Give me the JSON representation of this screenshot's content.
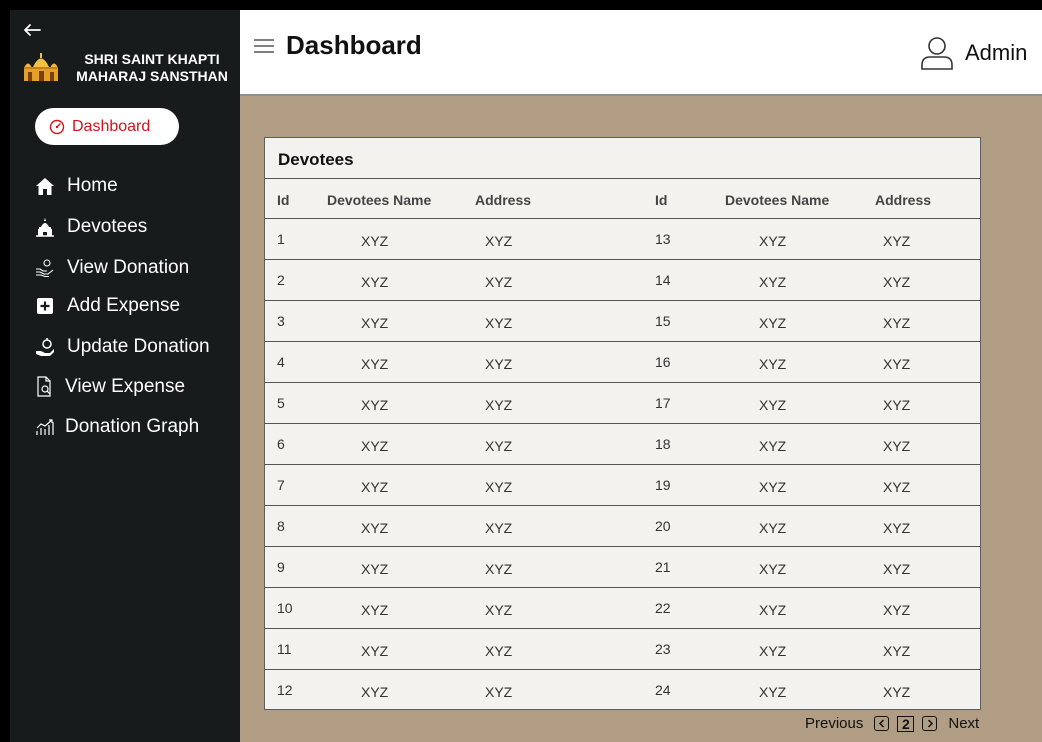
{
  "sidebar": {
    "brand_line1": "SHRI SAINT KHAPTI",
    "brand_line2": "MAHARAJ SANSTHAN",
    "active_label": "Dashboard",
    "items": [
      {
        "label": "Home",
        "icon": "home-icon"
      },
      {
        "label": "Devotees",
        "icon": "temple-icon"
      },
      {
        "label": "View Donation",
        "icon": "donation-hand-icon"
      },
      {
        "label": "Add Expense",
        "icon": "plus-square-icon"
      },
      {
        "label": "Update Donation",
        "icon": "money-hand-icon"
      },
      {
        "label": "View Expense",
        "icon": "document-search-icon"
      },
      {
        "label": "Donation Graph",
        "icon": "bar-graph-icon"
      }
    ]
  },
  "header": {
    "title": "Dashboard",
    "user": "Admin"
  },
  "table": {
    "title": "Devotees",
    "columns": [
      "Id",
      "Devotees Name",
      "Address",
      "Id",
      "Devotees Name",
      "Address"
    ],
    "rows": [
      [
        "1",
        "XYZ",
        "XYZ",
        "13",
        "XYZ",
        "XYZ"
      ],
      [
        "2",
        "XYZ",
        "XYZ",
        "14",
        "XYZ",
        "XYZ"
      ],
      [
        "3",
        "XYZ",
        "XYZ",
        "15",
        "XYZ",
        "XYZ"
      ],
      [
        "4",
        "XYZ",
        "XYZ",
        "16",
        "XYZ",
        "XYZ"
      ],
      [
        "5",
        "XYZ",
        "XYZ",
        "17",
        "XYZ",
        "XYZ"
      ],
      [
        "6",
        "XYZ",
        "XYZ",
        "18",
        "XYZ",
        "XYZ"
      ],
      [
        "7",
        "XYZ",
        "XYZ",
        "19",
        "XYZ",
        "XYZ"
      ],
      [
        "8",
        "XYZ",
        "XYZ",
        "20",
        "XYZ",
        "XYZ"
      ],
      [
        "9",
        "XYZ",
        "XYZ",
        "21",
        "XYZ",
        "XYZ"
      ],
      [
        "10",
        "XYZ",
        "XYZ",
        "22",
        "XYZ",
        "XYZ"
      ],
      [
        "11",
        "XYZ",
        "XYZ",
        "23",
        "XYZ",
        "XYZ"
      ],
      [
        "12",
        "XYZ",
        "XYZ",
        "24",
        "XYZ",
        "XYZ"
      ]
    ]
  },
  "pagination": {
    "previous": "Previous",
    "page": "2",
    "next": "Next"
  },
  "colors": {
    "sidebar_bg": "#171b1c",
    "content_bg": "#b09d84",
    "active_red": "#d0151b",
    "card_bg": "#f4f2ee"
  }
}
